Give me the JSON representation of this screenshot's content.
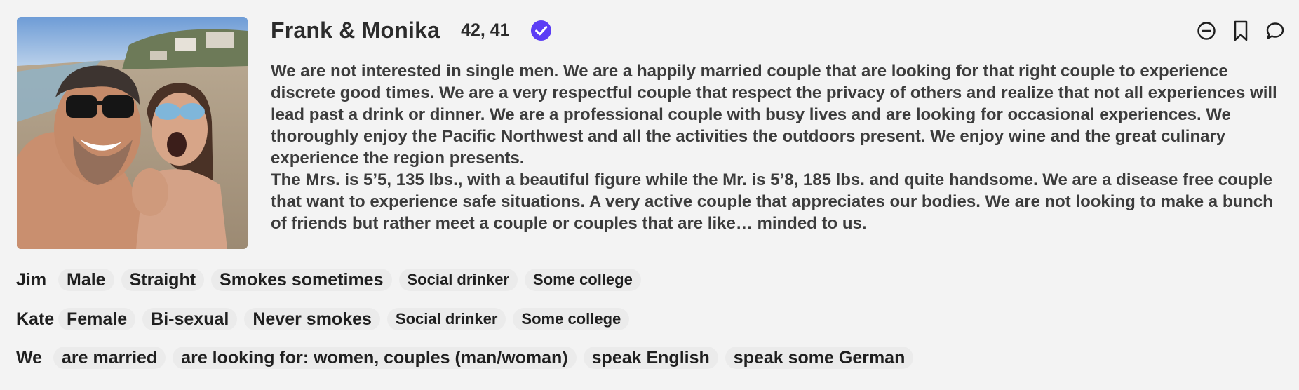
{
  "profile": {
    "name": "Frank & Monika",
    "ages": "42, 41",
    "verified": true,
    "accent_color": "#5b3df5"
  },
  "actions": [
    {
      "icon": "minus-circle-icon",
      "label": "hide"
    },
    {
      "icon": "bookmark-icon",
      "label": "bookmark"
    },
    {
      "icon": "chat-bubble-icon",
      "label": "message"
    }
  ],
  "bio": {
    "paragraph1": "We are not interested in single men. We are a happily married couple that are looking for that right couple to experience discrete good times. We are a very respectful couple that respect the privacy of others and realize that not all experiences will lead past a drink or dinner. We are a professional couple with busy lives and are looking for occasional experiences. We thoroughly enjoy the Pacific Northwest and all the activities the outdoors present. We enjoy wine and the great culinary experience the region presents.",
    "paragraph2": "The Mrs. is 5’5, 135 lbs., with a beautiful figure while the Mr. is 5’8, 185 lbs. and quite handsome. We are a disease free couple that want to experience safe situations. A very active couple that appreciates our bodies. We are not looking to make a bunch of friends but rather meet a couple or couples that are like… minded to us."
  },
  "attributes": {
    "person1": {
      "label": "Jim",
      "chips": [
        "Male",
        "Straight",
        "Smokes sometimes",
        "Social drinker",
        "Some college"
      ]
    },
    "person2": {
      "label": "Kate",
      "chips": [
        "Female",
        "Bi-sexual",
        "Never smokes",
        "Social drinker",
        "Some college"
      ]
    },
    "we": {
      "label": "We",
      "chips": [
        "are married",
        "are looking for: women, couples (man/woman)",
        "speak English",
        "speak some German"
      ]
    }
  }
}
